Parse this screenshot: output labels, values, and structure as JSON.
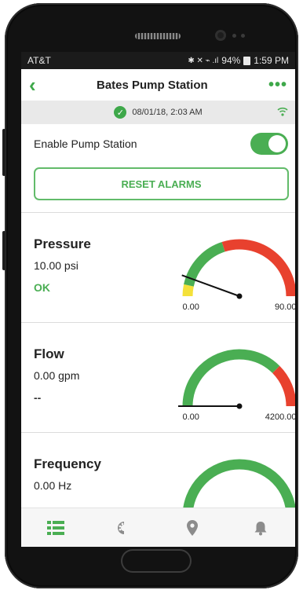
{
  "statusbar": {
    "carrier": "AT&T",
    "icons_text": "✱ ✕ ⌁ .ıl",
    "battery": "94%",
    "time": "1:59 PM"
  },
  "header": {
    "back_icon": "chevron-left-icon",
    "title": "Bates Pump Station",
    "menu_icon": "more-dots-icon"
  },
  "sync": {
    "timestamp": "08/01/18, 2:03 AM"
  },
  "enable": {
    "label": "Enable Pump Station",
    "on": true
  },
  "reset_label": "RESET ALARMS",
  "metrics": [
    {
      "name": "Pressure",
      "value": "10.00 psi",
      "status": "OK",
      "min": "0.00",
      "max": "90.00",
      "reading": 10.0,
      "range": [
        0,
        90
      ],
      "segments": [
        {
          "color": "#f4e13a",
          "from": 0,
          "to": 6
        },
        {
          "color": "#4aae53",
          "from": 6,
          "to": 36
        },
        {
          "color": "#e8412e",
          "from": 36,
          "to": 90
        }
      ]
    },
    {
      "name": "Flow",
      "value": "0.00 gpm",
      "status": "--",
      "min": "0.00",
      "max": "4200.00",
      "reading": 0.0,
      "range": [
        0,
        4200
      ],
      "segments": [
        {
          "color": "#4aae53",
          "from": 0,
          "to": 3150
        },
        {
          "color": "#e8412e",
          "from": 3150,
          "to": 4200
        }
      ]
    },
    {
      "name": "Frequency",
      "value": "0.00 Hz",
      "status": "",
      "min": "",
      "max": "",
      "reading": null,
      "range": [
        0,
        60
      ],
      "segments": [
        {
          "color": "#4aae53",
          "from": 0,
          "to": 60
        }
      ]
    }
  ],
  "nav": [
    {
      "icon": "list-icon",
      "active": true
    },
    {
      "icon": "palette-icon",
      "active": false
    },
    {
      "icon": "location-pin-icon",
      "active": false
    },
    {
      "icon": "bell-icon",
      "active": false
    }
  ],
  "colors": {
    "accent": "#4aae53",
    "alarm": "#e8412e",
    "warning": "#f4e13a"
  }
}
